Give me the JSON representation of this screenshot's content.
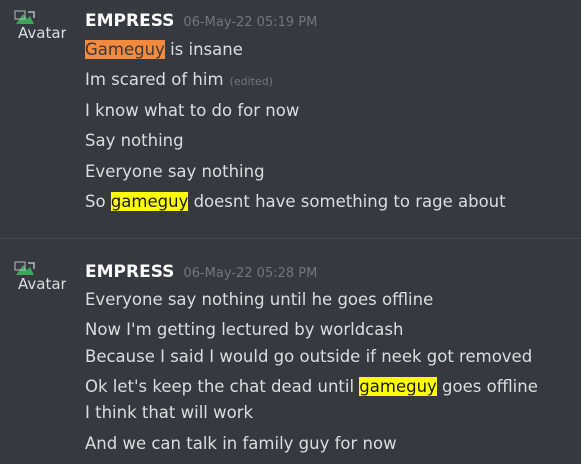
{
  "groups": [
    {
      "avatar_alt": "Avatar",
      "username": "EMPRESS",
      "timestamp": "06-May-22 05:19 PM",
      "lines": [
        {
          "parts": [
            {
              "text": "Gameguy",
              "hl": "orange"
            },
            {
              "text": " is insane"
            }
          ]
        },
        {
          "parts": [
            {
              "text": "Im scared of him"
            }
          ],
          "edited": "(edited)"
        },
        {
          "parts": [
            {
              "text": "I know what to do for now"
            }
          ]
        },
        {
          "parts": [
            {
              "text": "Say nothing"
            }
          ]
        },
        {
          "parts": [
            {
              "text": "Everyone say nothing"
            }
          ]
        },
        {
          "parts": [
            {
              "text": "So "
            },
            {
              "text": "gameguy",
              "hl": "yellow"
            },
            {
              "text": " doesnt have something to rage about"
            }
          ]
        }
      ]
    },
    {
      "avatar_alt": "Avatar",
      "username": "EMPRESS",
      "timestamp": "06-May-22 05:28 PM",
      "lines": [
        {
          "parts": [
            {
              "text": "Everyone say nothing until he goes offline"
            }
          ]
        },
        {
          "parts": [
            {
              "text": "Now I'm getting lectured by worldcash"
            }
          ]
        },
        {
          "parts": [
            {
              "text": "Because I said I would go outside if neek got removed"
            }
          ]
        },
        {
          "parts": [
            {
              "text": "Ok let's keep the chat dead until "
            },
            {
              "text": "gameguy",
              "hl": "yellow"
            },
            {
              "text": " goes offline"
            }
          ]
        },
        {
          "parts": [
            {
              "text": "I think that will work"
            }
          ]
        },
        {
          "parts": [
            {
              "text": "And we can talk in family guy for now"
            }
          ]
        }
      ]
    }
  ],
  "colors": {
    "background": "#36393f",
    "text": "#dcddde",
    "username": "#ffffff",
    "muted": "#72767d",
    "mention_orange": "#f48a3e",
    "mention_yellow": "#ffff05",
    "broken_image_icon": "#3ba55c"
  }
}
